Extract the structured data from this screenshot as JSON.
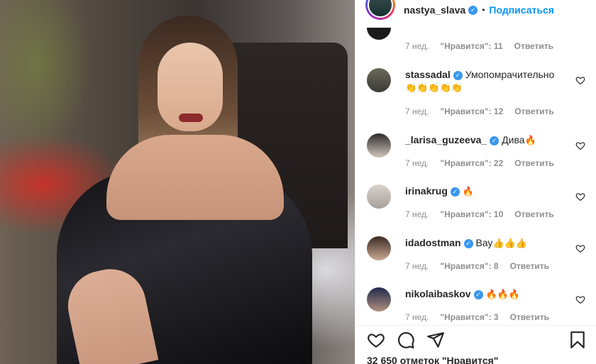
{
  "post": {
    "username": "nastya_slava",
    "follow_label": "Подписаться",
    "separator": "•"
  },
  "first_meta": {
    "time": "7 нед.",
    "likes": "\"Нравится\": 11",
    "reply": "Ответить"
  },
  "comments": [
    {
      "username": "stassadal",
      "verified": true,
      "text": "Умопомрачительно",
      "emoji": "👏👏👏👏👏",
      "time": "7 нед.",
      "likes": "\"Нравится\": 12",
      "reply": "Ответить"
    },
    {
      "username": "_larisa_guzeeva_",
      "verified": true,
      "text": "Дива",
      "emoji": "🔥",
      "time": "7 нед.",
      "likes": "\"Нравится\": 22",
      "reply": "Ответить"
    },
    {
      "username": "irinakrug",
      "verified": true,
      "text": "",
      "emoji": "🔥",
      "time": "7 нед.",
      "likes": "\"Нравится\": 10",
      "reply": "Ответить"
    },
    {
      "username": "idadostman",
      "verified": true,
      "text": "Вау",
      "emoji": "👍👍👍",
      "time": "7 нед.",
      "likes": "\"Нравится\": 8",
      "reply": "Ответить"
    },
    {
      "username": "nikolaibaskov",
      "verified": true,
      "text": "",
      "emoji": "🔥🔥🔥",
      "time": "7 нед.",
      "likes": "\"Нравится\": 3",
      "reply": "Ответить"
    }
  ],
  "likes_count": "32 650 отметок \"Нравится\"",
  "icons": [
    "heart-icon",
    "comment-icon",
    "share-icon",
    "bookmark-icon",
    "verified-badge-icon"
  ],
  "colors": {
    "accent": "#0095f6",
    "verified": "#3897f0",
    "muted": "#8e8e8e"
  }
}
